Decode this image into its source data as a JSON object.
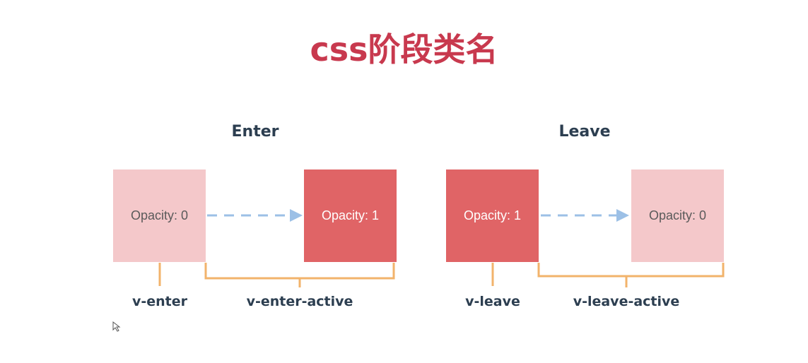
{
  "title": "css阶段类名",
  "enter": {
    "label": "Enter",
    "from_box": "Opacity: 0",
    "to_box": "Opacity: 1",
    "phase_start": "v-enter",
    "phase_active": "v-enter-active"
  },
  "leave": {
    "label": "Leave",
    "from_box": "Opacity: 1",
    "to_box": "Opacity: 0",
    "phase_start": "v-leave",
    "phase_active": "v-leave-active"
  },
  "colors": {
    "title": "#c8394e",
    "light_box": "#f4c8ca",
    "dark_box": "#e06466",
    "arrow": "#9cc0e6",
    "bracket": "#f2b36b",
    "label_text": "#2c3e50"
  }
}
